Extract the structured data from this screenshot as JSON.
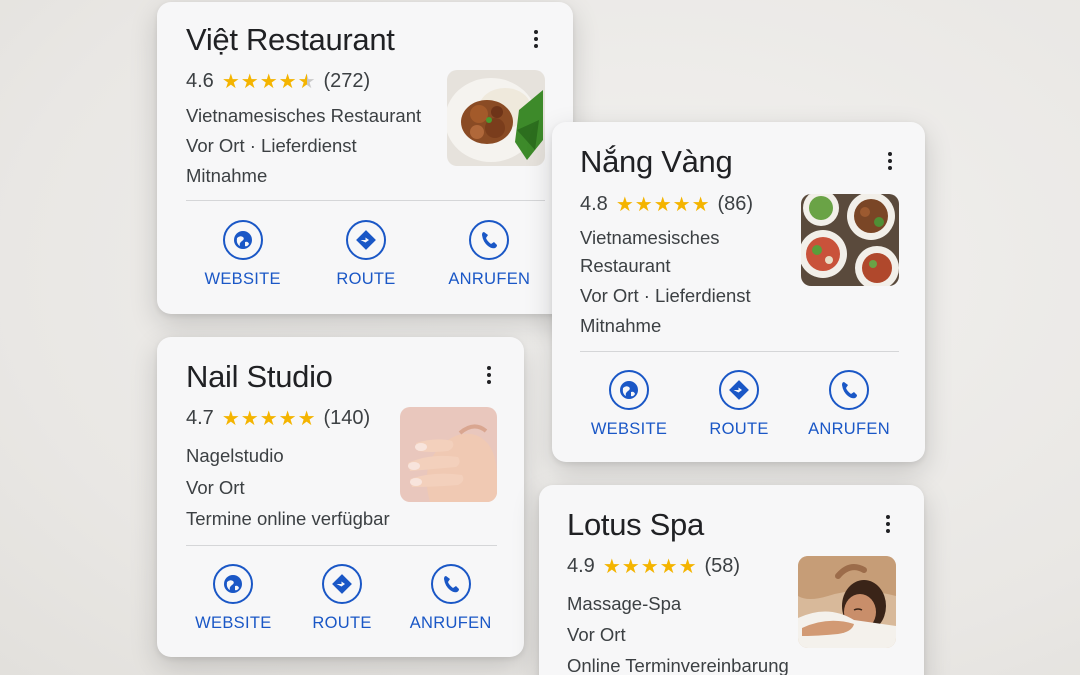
{
  "colors": {
    "accent": "#1a57c6",
    "star": "#f4b400",
    "card": "#f7f7f8",
    "text": "#202124"
  },
  "actions": {
    "website": "WEBSITE",
    "route": "ROUTE",
    "call": "ANRUFEN"
  },
  "cards": [
    {
      "title": "Việt Restaurant",
      "rating": "4.6",
      "stars": 4.6,
      "reviews": "(272)",
      "lines": [
        "Vietnamesisches Restaurant",
        "Vor Ort · Lieferdienst",
        "Mitnahme"
      ],
      "thumb": "food-plate"
    },
    {
      "title": "Nắng Vàng",
      "rating": "4.8",
      "stars": 4.8,
      "reviews": "(86)",
      "lines": [
        "Vietnamesisches",
        "Restaurant",
        "Vor Ort · Lieferdienst",
        "Mitnahme"
      ],
      "thumb": "food-bowls"
    },
    {
      "title": "Nail Studio",
      "rating": "4.7",
      "stars": 4.7,
      "reviews": "(140)",
      "lines": [
        "Nagelstudio",
        "Vor Ort",
        "Termine online verfügbar"
      ],
      "thumb": "manicure"
    },
    {
      "title": "Lotus Spa",
      "rating": "4.9",
      "stars": 4.9,
      "reviews": "(58)",
      "lines": [
        "Massage-Spa",
        "Vor Ort",
        "Online Terminvereinbarung"
      ],
      "thumb": "spa-massage"
    }
  ]
}
